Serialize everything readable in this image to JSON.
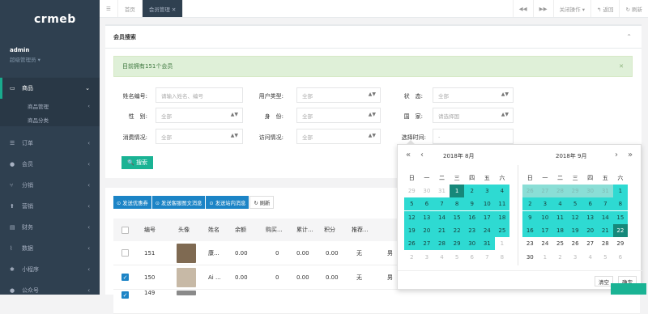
{
  "sidebar": {
    "logo": "crmeb",
    "admin_name": "admin",
    "admin_role": "超级管理员 ▾",
    "items": [
      {
        "icon": "▭",
        "label": "商品",
        "active": true,
        "children": [
          {
            "label": "商品管理"
          },
          {
            "label": "商品分类"
          }
        ]
      },
      {
        "icon": "☰",
        "label": "订单"
      },
      {
        "icon": "●",
        "label": "会员"
      },
      {
        "icon": "⑂",
        "label": "分销"
      },
      {
        "icon": "⬆",
        "label": "营销"
      },
      {
        "icon": "▤",
        "label": "财务"
      },
      {
        "icon": "⌇",
        "label": "数据"
      },
      {
        "icon": "✱",
        "label": "小程序"
      },
      {
        "icon": "●",
        "label": "公众号"
      }
    ]
  },
  "topbar": {
    "menu_icon": "☰",
    "back_icon": "◀◀",
    "tabs": [
      {
        "label": "首页"
      },
      {
        "label": "会员管理 ✕",
        "active": true
      }
    ],
    "fwd_icon": "▶▶",
    "close_ops": "关闭操作 ▾",
    "back": "↰ 返回",
    "refresh": "↻ 刷新"
  },
  "panel": {
    "title": "会员搜索",
    "alert": "目前拥有151个会员",
    "form": {
      "name_label": "姓名编号:",
      "name_placeholder": "请输入姓名、编号",
      "usertype_label": "用户类型:",
      "usertype_value": "全部",
      "status_label": "状　态:",
      "status_value": "全部",
      "gender_label": "性　别:",
      "gender_value": "全部",
      "identity_label": "身　份:",
      "identity_value": "全部",
      "country_label": "国　家:",
      "country_value": "请选择国",
      "consume_label": "消费情况:",
      "consume_value": "全部",
      "visit_label": "访问情况:",
      "visit_value": "全部",
      "time_label": "选择时间:",
      "time_value": "-"
    },
    "search_btn": "🔍 搜索"
  },
  "actions": [
    "⊙ 发送优惠券",
    "⊙ 发送客服图文消息",
    "⊙ 发送站内消息",
    "↻ 刷新"
  ],
  "table": {
    "headers": [
      "",
      "编号",
      "头像",
      "姓名",
      "余额",
      "购买...",
      "累计...",
      "积分",
      "推荐...",
      ""
    ],
    "rows": [
      {
        "checked": false,
        "id": "151",
        "name": "康...",
        "balance": "0.00",
        "buy": "0",
        "total": "0.00",
        "points": "0.00",
        "rec": "无",
        "gender": "男"
      },
      {
        "checked": true,
        "id": "150",
        "name": "Ai ...",
        "balance": "0.00",
        "buy": "0",
        "total": "0.00",
        "points": "0.00",
        "rec": "无",
        "gender": "男"
      },
      {
        "checked": true,
        "id": "149",
        "name": "...",
        "balance": "",
        "buy": "",
        "total": "",
        "points": "",
        "rec": "",
        "gender": ""
      }
    ]
  },
  "datepicker": {
    "left_title": "2018年  8月",
    "right_title": "2018年  9月",
    "weekdays": [
      "日",
      "一",
      "二",
      "三",
      "四",
      "五",
      "六"
    ],
    "left_days": [
      "29",
      "30",
      "31",
      "1",
      "2",
      "3",
      "4",
      "5",
      "6",
      "7",
      "8",
      "9",
      "10",
      "11",
      "12",
      "13",
      "14",
      "15",
      "16",
      "17",
      "18",
      "19",
      "20",
      "21",
      "22",
      "23",
      "24",
      "25",
      "26",
      "27",
      "28",
      "29",
      "30",
      "31",
      "1",
      "2",
      "3",
      "4",
      "5",
      "6",
      "7",
      "8"
    ],
    "right_days": [
      "26",
      "27",
      "28",
      "29",
      "30",
      "31",
      "1",
      "2",
      "3",
      "4",
      "5",
      "6",
      "7",
      "8",
      "9",
      "10",
      "11",
      "12",
      "13",
      "14",
      "15",
      "16",
      "17",
      "18",
      "19",
      "20",
      "21",
      "22",
      "23",
      "24",
      "25",
      "26",
      "27",
      "28",
      "29",
      "30",
      "1",
      "2",
      "3",
      "4",
      "5",
      "6"
    ],
    "clear_label": "清空",
    "ok_label": "确定"
  },
  "colors": {
    "sidebar": "#2f4050",
    "accent": "#1ab394",
    "range": "#2edad2",
    "selected": "#16887a",
    "blue": "#1c84c6"
  }
}
